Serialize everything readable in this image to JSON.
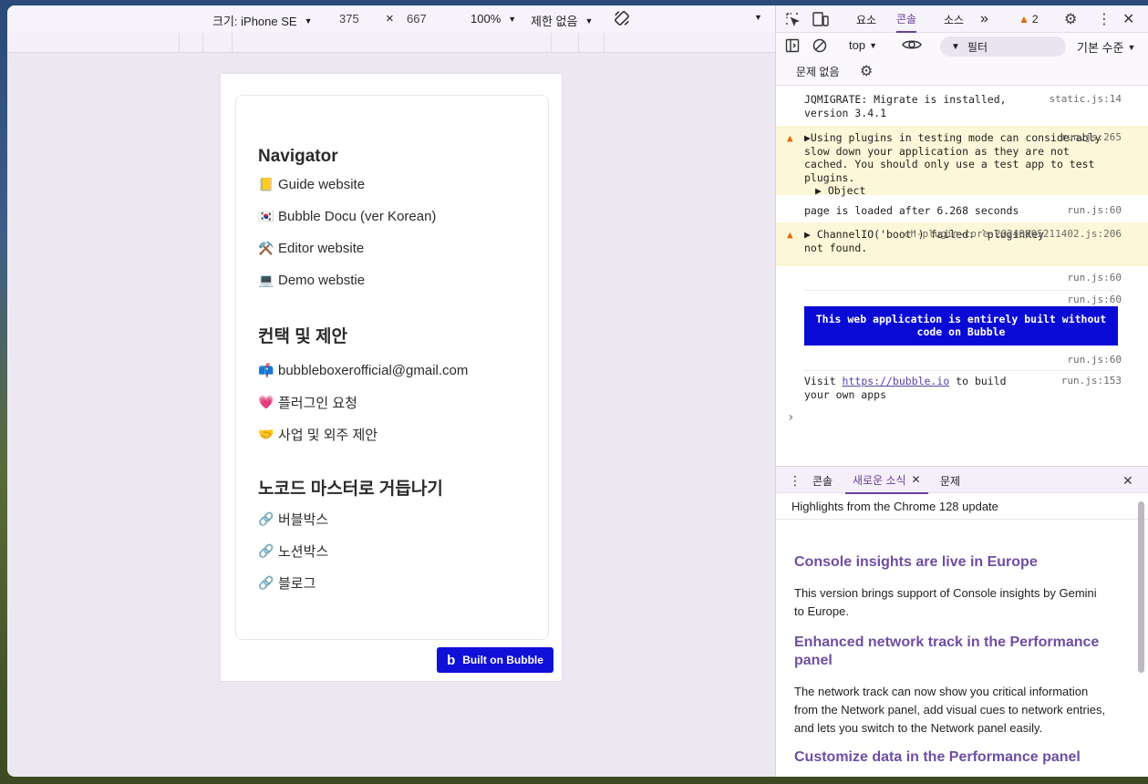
{
  "device_toolbar": {
    "device_label": "크기: iPhone SE",
    "width": "375",
    "times": "×",
    "height": "667",
    "zoom": "100%",
    "throttle": "제한 없음"
  },
  "page": {
    "sections": [
      {
        "title": "Navigator",
        "links": [
          {
            "emoji": "📒",
            "label": "Guide website"
          },
          {
            "emoji": "🇰🇷",
            "label": "Bubble Docu (ver Korean)"
          },
          {
            "emoji": "⚒️",
            "label": "Editor website"
          },
          {
            "emoji": "💻",
            "label": "Demo webstie"
          }
        ]
      },
      {
        "title": "컨택 및 제안",
        "links": [
          {
            "emoji": "📫",
            "label": "bubbleboxerofficial@gmail.com"
          },
          {
            "emoji": "💗",
            "label": "플러그인 요청"
          },
          {
            "emoji": "🤝",
            "label": "사업 및 외주 제안"
          }
        ]
      },
      {
        "title": "노코드 마스터로 거듭나기",
        "links": [
          {
            "emoji": "🔗",
            "label": "버블박스"
          },
          {
            "emoji": "🔗",
            "label": "노션박스"
          },
          {
            "emoji": "🔗",
            "label": "블로그"
          }
        ]
      }
    ],
    "badge": {
      "logo": "b",
      "label": "Built on Bubble"
    }
  },
  "devtools": {
    "tabs": [
      "요소",
      "콘솔",
      "소스"
    ],
    "active_tab": "콘솔",
    "more": "»",
    "issues_count": "2",
    "toolbar": {
      "context": "top",
      "filter_placeholder": "필터",
      "level": "기본 수준",
      "issues": "문제 없음"
    },
    "console": [
      {
        "type": "log",
        "text": "JQMIGRATE: Migrate is installed, version 3.4.1",
        "src": "static.js:14"
      },
      {
        "type": "warn",
        "text": "▶Using plugins in testing mode can considerably slow down your application as they are not cached. You should only use a test app to test plugins.",
        "src": "run.js:265",
        "extra": "▶ Object"
      },
      {
        "type": "log",
        "text": "page is loaded after 6.268 seconds",
        "src": "run.js:60"
      },
      {
        "type": "warn",
        "text": "▶ ChannelIO('boot') failed: `pluginKey` not found.",
        "src": "ch-plugin-core-20240905211402.js:206"
      },
      {
        "type": "log",
        "text": "",
        "src": "run.js:60"
      },
      {
        "type": "log",
        "text": "",
        "src": "run.js:60"
      },
      {
        "type": "styled",
        "text": "This web application is entirely built without code on Bubble"
      },
      {
        "type": "log",
        "text": "",
        "src": "run.js:60"
      },
      {
        "type": "log",
        "text_prefix": "Visit ",
        "link": "https://bubble.io",
        "text_suffix": " to build your own apps",
        "src": "run.js:153"
      }
    ],
    "prompt": "›",
    "drawer": {
      "tabs": [
        "콘솔",
        "새로운 소식",
        "문제"
      ],
      "active": "새로운 소식",
      "header": "Highlights from the Chrome 128 update",
      "items": [
        {
          "h": "Console insights are live in Europe",
          "p": "This version brings support of Console insights by Gemini to Europe."
        },
        {
          "h": "Enhanced network track in the Performance panel",
          "p": "The network track can now show you critical information from the Network panel, add visual cues to network entries, and lets you switch to the Network panel easily."
        },
        {
          "h": "Customize data in the Performance panel",
          "p": ""
        }
      ]
    }
  }
}
